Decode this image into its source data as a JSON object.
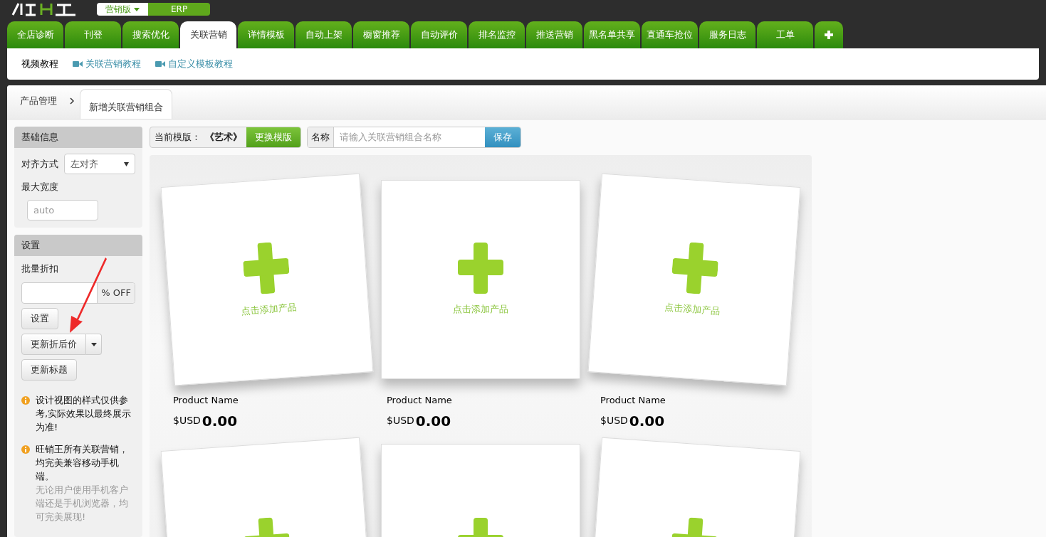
{
  "header": {
    "edition_menu": "营销版",
    "erp_button": "ERP"
  },
  "tabs": [
    {
      "label": "全店诊断",
      "selected": false
    },
    {
      "label": "刊登",
      "selected": false
    },
    {
      "label": "搜索优化",
      "selected": false
    },
    {
      "label": "关联营销",
      "selected": true
    },
    {
      "label": "详情模板",
      "selected": false
    },
    {
      "label": "自动上架",
      "selected": false
    },
    {
      "label": "橱窗推荐",
      "selected": false
    },
    {
      "label": "自动评价",
      "selected": false
    },
    {
      "label": "排名监控",
      "selected": false
    },
    {
      "label": "推送营销",
      "selected": false
    },
    {
      "label": "黑名单共享",
      "selected": false
    },
    {
      "label": "直通车抢位",
      "selected": false
    },
    {
      "label": "服务日志",
      "selected": false
    },
    {
      "label": "工单",
      "selected": false
    }
  ],
  "video_bar": {
    "label": "视频教程",
    "links": [
      "关联营销教程",
      "自定义模板教程"
    ]
  },
  "breadcrumb": [
    {
      "label": "产品管理",
      "selected": false
    },
    {
      "label": "新增关联营销组合",
      "selected": true
    }
  ],
  "sidebar": {
    "basic": {
      "title": "基础信息",
      "align_label": "对齐方式",
      "align_value": "左对齐",
      "width_label": "最大宽度",
      "width_placeholder": "auto"
    },
    "settings": {
      "title": "设置",
      "discount_label": "批量折扣",
      "discount_suffix": "% OFF",
      "set_button": "设置",
      "update_price_button": "更新折后价",
      "update_title_button": "更新标题"
    },
    "notes": [
      {
        "text": "设计视图的样式仅供参考,实际效果以最终展示为准!"
      },
      {
        "text": "旺销王所有关联营销，均完美兼容移动手机端。",
        "detail": "无论用户使用手机客户端还是手机浏览器，均可完美展现!"
      }
    ]
  },
  "toolbar": {
    "template_label": "当前模版：",
    "template_name": "《艺术》",
    "change_button": "更换模版",
    "name_label": "名称",
    "name_placeholder": "请输入关联营销组合名称",
    "save_button": "保存"
  },
  "cards": [
    {
      "kind": "product",
      "caption": "点击添加产品",
      "product_name": "Product Name",
      "currency": "$USD",
      "price": "0.00"
    },
    {
      "kind": "product",
      "caption": "点击添加产品",
      "product_name": "Product Name",
      "currency": "$USD",
      "price": "0.00"
    },
    {
      "kind": "product",
      "caption": "点击添加产品",
      "product_name": "Product Name",
      "currency": "$USD",
      "price": "0.00"
    },
    {
      "kind": "slot"
    },
    {
      "kind": "slot"
    },
    {
      "kind": "slot"
    }
  ]
}
